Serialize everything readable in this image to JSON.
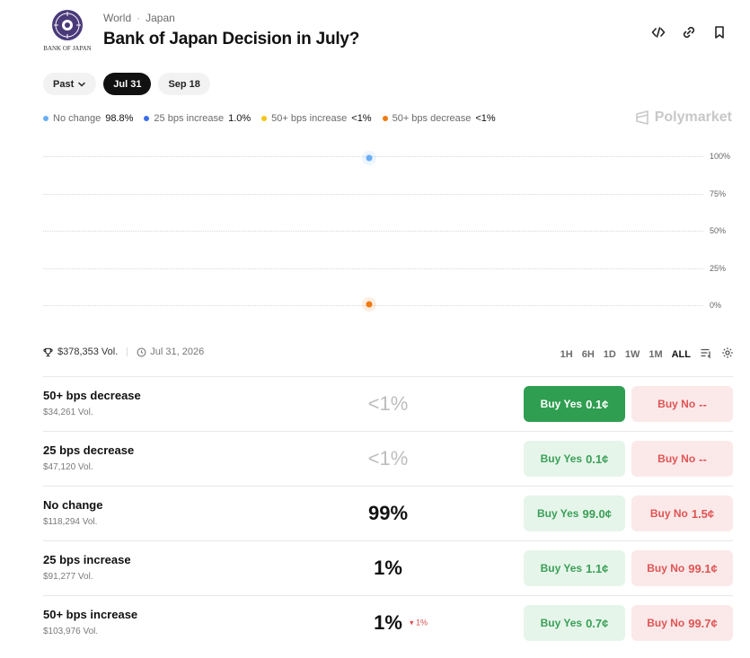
{
  "header": {
    "logo_text": "BANK OF JAPAN",
    "crumbs": [
      "World",
      "Japan"
    ],
    "title": "Bank of Japan Decision in July?"
  },
  "icons": [
    "code-icon",
    "link-icon",
    "bookmark-icon"
  ],
  "pills": [
    {
      "label": "Past",
      "active": false
    },
    {
      "label": "Jul 31",
      "active": true
    },
    {
      "label": "Sep 18",
      "active": false
    }
  ],
  "legend": [
    {
      "label": "No change",
      "value": "98.8%",
      "color": "#6aaef5"
    },
    {
      "label": "25 bps increase",
      "value": "1.0%",
      "color": "#3b6ee8"
    },
    {
      "label": "50+ bps increase",
      "value": "<1%",
      "color": "#f5c518"
    },
    {
      "label": "50+ bps decrease",
      "value": "<1%",
      "color": "#f07a10"
    }
  ],
  "brand": "Polymarket",
  "chart": {
    "y_ticks": [
      "100%",
      "75%",
      "50%",
      "25%",
      "0%"
    ],
    "points": [
      {
        "series": "No change",
        "value": 98.8,
        "color": "#6aaef5"
      },
      {
        "series": "50+ bps decrease",
        "value": 0.5,
        "color": "#f07a10"
      }
    ]
  },
  "meta": {
    "volume": "$378,353 Vol.",
    "date": "Jul 31, 2026"
  },
  "ranges": [
    {
      "label": "1H",
      "active": false
    },
    {
      "label": "6H",
      "active": false
    },
    {
      "label": "1D",
      "active": false
    },
    {
      "label": "1W",
      "active": false
    },
    {
      "label": "1M",
      "active": false
    },
    {
      "label": "ALL",
      "active": true
    }
  ],
  "outcomes": [
    {
      "name": "50+ bps decrease",
      "volume": "$34,261 Vol.",
      "pct": "<1%",
      "muted": true,
      "delta": "",
      "yes_label": "Buy Yes",
      "yes_price": "0.1¢",
      "yes_strong": true,
      "no_label": "Buy No",
      "no_price": "--"
    },
    {
      "name": "25 bps decrease",
      "volume": "$47,120 Vol.",
      "pct": "<1%",
      "muted": true,
      "delta": "",
      "yes_label": "Buy Yes",
      "yes_price": "0.1¢",
      "yes_strong": false,
      "no_label": "Buy No",
      "no_price": "--"
    },
    {
      "name": "No change",
      "volume": "$118,294 Vol.",
      "pct": "99%",
      "muted": false,
      "delta": "",
      "yes_label": "Buy Yes",
      "yes_price": "99.0¢",
      "yes_strong": false,
      "no_label": "Buy No",
      "no_price": "1.5¢"
    },
    {
      "name": "25 bps increase",
      "volume": "$91,277 Vol.",
      "pct": "1%",
      "muted": false,
      "delta": "",
      "yes_label": "Buy Yes",
      "yes_price": "1.1¢",
      "yes_strong": false,
      "no_label": "Buy No",
      "no_price": "99.1¢"
    },
    {
      "name": "50+ bps increase",
      "volume": "$103,976 Vol.",
      "pct": "1%",
      "muted": false,
      "delta": "▾ 1%",
      "yes_label": "Buy Yes",
      "yes_price": "0.7¢",
      "yes_strong": false,
      "no_label": "Buy No",
      "no_price": "99.7¢"
    }
  ]
}
